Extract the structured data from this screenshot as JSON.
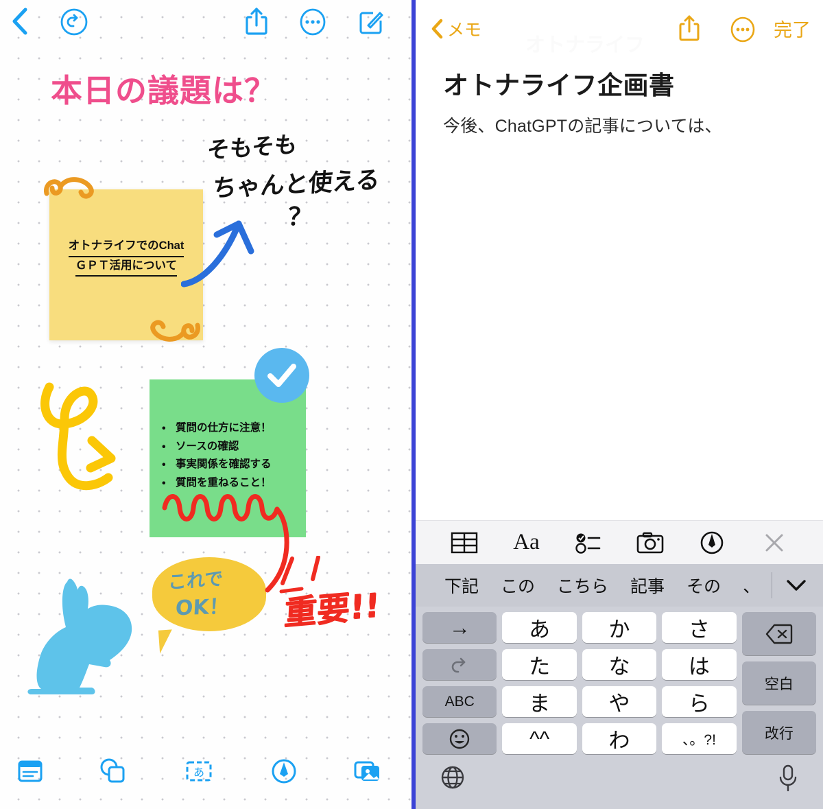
{
  "colors": {
    "accent_blue": "#1ba1f2",
    "divider_blue": "#3b43d6",
    "title_pink": "#ef4e8c",
    "sticky_yellow": "#f8dd7e",
    "sticky_green": "#79dd8a",
    "swirl_orange": "#eb9a22",
    "scribble_yellow": "#fbc707",
    "red_ink": "#f02b21",
    "rabbit_blue": "#5ec3ea",
    "bubble_yellow": "#f5ca3c",
    "notes_amber": "#eaa716",
    "check_badge_blue": "#5ab8ef"
  },
  "left_panel": {
    "top_toolbar": {
      "back": "back-chevron-icon",
      "undo": "undo-circle-icon",
      "share": "share-icon",
      "more": "more-circle-icon",
      "compose": "compose-icon"
    },
    "canvas": {
      "title": "本日の議題は？",
      "handwriting": {
        "line1": "そもそも",
        "line2": "ちゃんと使える",
        "line3": "？"
      },
      "sticky_yellow": {
        "line1": "オトナライフでのChat",
        "line2": "ＧＰＴ活用について",
        "swirl_top_left": "swirl-ornament-icon",
        "swirl_bottom_right": "swirl-ornament-icon"
      },
      "sticky_green": {
        "bullets": [
          "質問の仕方に注意！",
          "ソースの確認",
          "事実関係を確認する",
          "質問を重ねること！"
        ],
        "badge": "check-circle-icon"
      },
      "speech_bubble": {
        "line1": "これで",
        "line2": "OK！"
      },
      "red_annotation": "重要!!",
      "rabbit": "rabbit-silhouette-icon",
      "blue_arrow": "blue-arrow-annotation",
      "yellow_scribble": "yellow-scribble-annotation",
      "red_squiggle": "red-squiggle-annotation"
    },
    "bottom_toolbar": [
      {
        "name": "note-icon",
        "label": "note"
      },
      {
        "name": "shapes-icon",
        "label": "shapes"
      },
      {
        "name": "text-box-icon",
        "label": "あ"
      },
      {
        "name": "markup-pen-icon",
        "label": "markup"
      },
      {
        "name": "media-icon",
        "label": "media"
      }
    ]
  },
  "right_panel": {
    "nav": {
      "back_label": "メモ",
      "back_icon": "back-chevron-icon",
      "share_icon": "share-icon",
      "more_icon": "more-circle-icon",
      "done_label": "完了"
    },
    "note": {
      "title": "オトナライフ企画書",
      "paragraph": "今後、ChatGPTの記事については、",
      "watermark": "オトナライフ"
    },
    "keyboard": {
      "format_bar": [
        {
          "name": "table-icon",
          "label": "table"
        },
        {
          "name": "text-format-icon",
          "label": "Aa"
        },
        {
          "name": "checklist-icon",
          "label": "checklist"
        },
        {
          "name": "camera-icon",
          "label": "camera"
        },
        {
          "name": "markup-pen-icon",
          "label": "markup"
        },
        {
          "name": "close-icon",
          "label": "×"
        }
      ],
      "suggestions": [
        "下記",
        "この",
        "こちら",
        "記事",
        "その",
        "、"
      ],
      "collapse_icon": "chevron-down-icon",
      "rows": [
        {
          "left": "→",
          "keys": [
            "あ",
            "か",
            "さ"
          ],
          "right": "delete-icon"
        },
        {
          "left": "undo-icon",
          "keys": [
            "た",
            "な",
            "は"
          ],
          "right": "空白"
        },
        {
          "left": "ABC",
          "keys": [
            "ま",
            "や",
            "ら"
          ],
          "right": "改行"
        },
        {
          "left": "emoji-icon",
          "keys": [
            "^^",
            "わ",
            "、。?!"
          ],
          "right": ""
        }
      ],
      "globe_icon": "globe-icon",
      "mic_icon": "microphone-icon"
    }
  }
}
